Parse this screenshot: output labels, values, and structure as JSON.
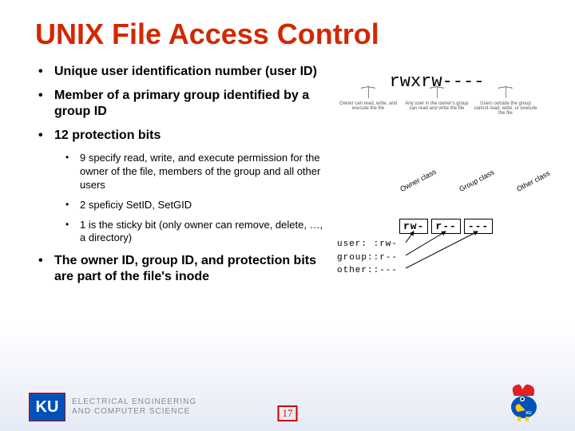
{
  "title": "UNIX File Access Control",
  "bullets": {
    "b1": "Unique user identification number (user ID)",
    "b2": "Member of a primary group identified by a group ID",
    "b3": "12 protection bits",
    "b3a": "9 specify read, write, and execute permission for the owner of the file, members of the group and all other users",
    "b3b": "2 speficiy SetID, SetGID",
    "b3c": "1 is the sticky bit (only owner can remove, delete, …, a directory)",
    "b4": "The owner ID, group ID, and protection bits are part of the file's inode"
  },
  "diagram_top": {
    "perm_string": "rwxrw----",
    "col1": "Owner can read, write, and execute the file",
    "col2": "Any user in the owner's group can read and write the file",
    "col3": "Users outside the group cannot read, write, or execute the file"
  },
  "diagram_bot": {
    "class1": "Owner class",
    "class2": "Group class",
    "class3": "Other class",
    "box1": "rw-",
    "box2": "r--",
    "box3": "---",
    "acl1": "user: :rw-",
    "acl2": "group::r--",
    "acl3": "other::---"
  },
  "footer": {
    "logo_text": "KU",
    "dept_line1": "ELECTRICAL ENGINEERING",
    "dept_line2": "AND COMPUTER SCIENCE",
    "page": "17"
  }
}
